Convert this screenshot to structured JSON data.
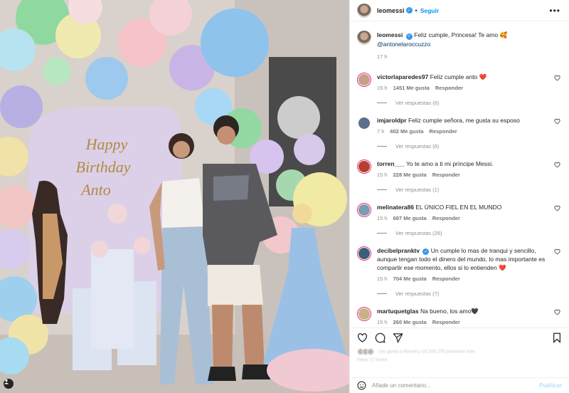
{
  "header": {
    "username": "leomessi",
    "separator": "•",
    "follow_label": "Seguir",
    "more_label": "•••"
  },
  "caption": {
    "username": "leomessi",
    "text": "Feliz cumple, Princesa! Te amo 🥰",
    "mention": "@antonelaroccuzzo",
    "time": "17 h"
  },
  "photo": {
    "sign_line1": "Happy",
    "sign_line2": "Birthday",
    "sign_line3": "Anto"
  },
  "comments": [
    {
      "username": "victorlaparedes97",
      "text": "Feliz cumple anto",
      "emoji": "❤️",
      "time": "15 h",
      "likes": "1451 Me gusta",
      "reply": "Responder",
      "replies": "Ver respuestas (6)",
      "color": "#c4a08a"
    },
    {
      "username": "imjaroldpr",
      "text": "Feliz cumple señora, me gusta su esposo",
      "emoji": "",
      "time": "7 h",
      "likes": "602 Me gusta",
      "reply": "Responder",
      "replies": "Ver respuestas (6)",
      "color": "#5b6f8a"
    },
    {
      "username": "torren___",
      "text": "Yo te amo a ti mi príncipe Messi.",
      "emoji": "",
      "time": "15 h",
      "likes": "228 Me gusta",
      "reply": "Responder",
      "replies": "Ver respuestas (1)",
      "color": "#b5402f"
    },
    {
      "username": "melinatera86",
      "text": "EL ÚNICO FIEL EN EL MUNDO",
      "emoji": "",
      "time": "15 h",
      "likes": "697 Me gusta",
      "reply": "Responder",
      "replies": "Ver respuestas (28)",
      "color": "#7d9bb5"
    },
    {
      "username": "decibelpranktv",
      "text": "Un cumple lo mas de tranqui y sencillo, aunque tengan todo el dinero del mundo, lo mas importante es compartir ese momento, ellos si lo entienden",
      "emoji": "❤️",
      "time": "15 h",
      "likes": "704 Me gusta",
      "reply": "Responder",
      "replies": "Ver respuestas (7)",
      "color": "#3b5f7a"
    },
    {
      "username": "martuquetglas",
      "text": "Na bueno, los amo🖤",
      "emoji": "",
      "time": "15 h",
      "likes": "260 Me gusta",
      "reply": "Responder",
      "replies": "",
      "color": "#c8b088"
    }
  ],
  "likes": {
    "summary": "Les gusta a fitonoll y 16.203.278 personas más",
    "time": "Hace 17 horas"
  },
  "add_comment": {
    "placeholder": "Añade un comentario...",
    "publish": "Publicar"
  },
  "icons": [
    "heart-icon",
    "comment-icon",
    "share-icon",
    "save-icon",
    "emoji-icon",
    "tag-person-icon",
    "verified-icon"
  ],
  "colors": {
    "accent": "#0095f6",
    "like_red": "#ed4956",
    "story_ring": "#e1306c"
  }
}
